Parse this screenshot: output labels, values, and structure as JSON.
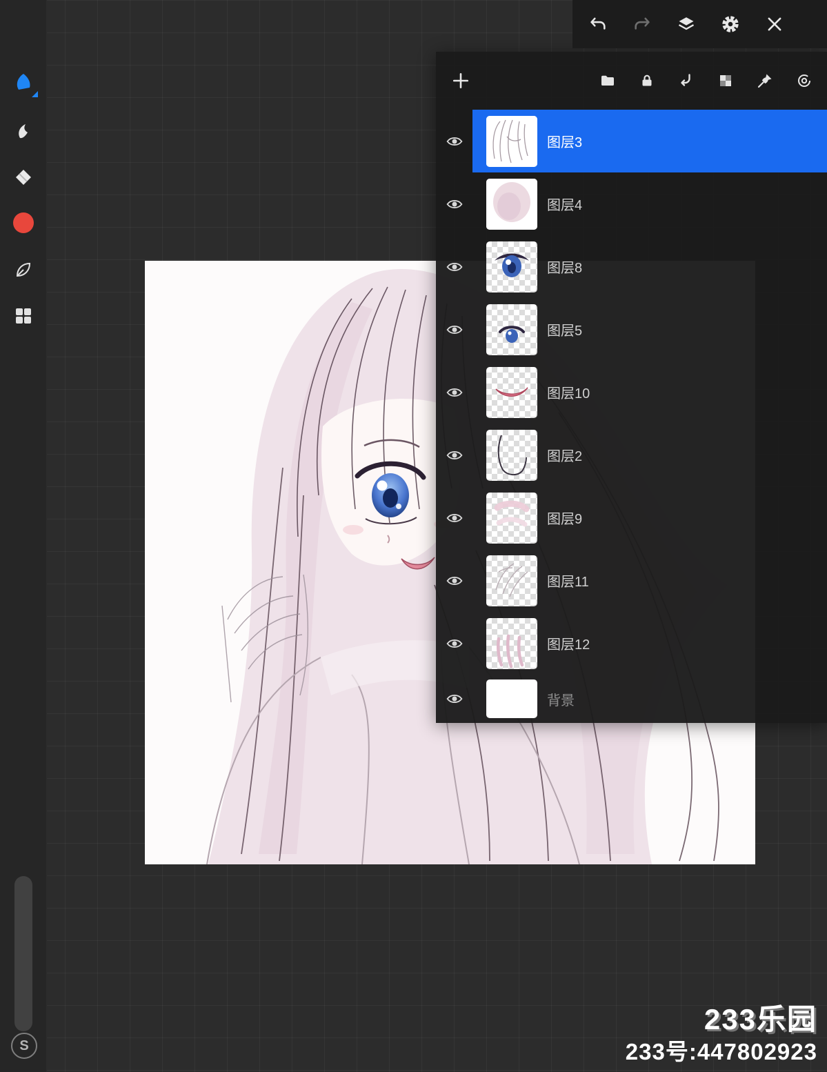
{
  "colors": {
    "selected_layer": "#1a6af0",
    "brush_tool_accent": "#1f86f5",
    "color_swatch": "#e8473c",
    "canvas_bg": "#fdfbfb",
    "panel_bg": "#1b1b1b"
  },
  "sidebar": {
    "tools": [
      {
        "name": "brush-tool",
        "active": true
      },
      {
        "name": "smudge-tool",
        "active": false
      },
      {
        "name": "eraser-tool",
        "active": false
      },
      {
        "name": "color-swatch",
        "active": false
      },
      {
        "name": "leaf-tool",
        "active": false
      },
      {
        "name": "layout-blocks-tool",
        "active": false
      }
    ],
    "bottom_badge": "S"
  },
  "top_toolbar": {
    "icons": [
      "undo",
      "redo",
      "layers",
      "settings",
      "close"
    ],
    "redo_disabled": true
  },
  "layers_panel": {
    "header_icons": [
      "add-layer",
      "folder",
      "lock",
      "clipping",
      "alpha-checker",
      "pin",
      "spiral"
    ],
    "layers": [
      {
        "name": "图层3",
        "selected": true,
        "visible": true,
        "thumb": "sketch"
      },
      {
        "name": "图层4",
        "selected": false,
        "visible": true,
        "thumb": "pink-wash"
      },
      {
        "name": "图层8",
        "selected": false,
        "visible": true,
        "thumb": "eye-large"
      },
      {
        "name": "图层5",
        "selected": false,
        "visible": true,
        "thumb": "eye-small"
      },
      {
        "name": "图层10",
        "selected": false,
        "visible": true,
        "thumb": "mouth"
      },
      {
        "name": "图层2",
        "selected": false,
        "visible": true,
        "thumb": "outline"
      },
      {
        "name": "图层9",
        "selected": false,
        "visible": true,
        "thumb": "pink-faint"
      },
      {
        "name": "图层11",
        "selected": false,
        "visible": true,
        "thumb": "sketch-light"
      },
      {
        "name": "图层12",
        "selected": false,
        "visible": true,
        "thumb": "pink-strokes"
      },
      {
        "name": "背景",
        "selected": false,
        "visible": true,
        "thumb": "white",
        "is_background": true
      }
    ]
  },
  "watermark": {
    "logo": "233乐园",
    "id_text": "233号:447802923"
  }
}
